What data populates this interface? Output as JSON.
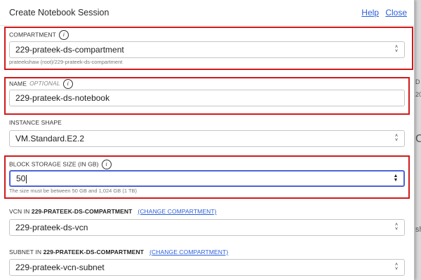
{
  "dialog": {
    "title": "Create Notebook Session",
    "help_link": "Help",
    "close_link": "Close"
  },
  "compartment": {
    "label": "COMPARTMENT",
    "value": "229-prateek-ds-compartment",
    "path": "prateekshaw (root)/229-prateek-ds-compartment"
  },
  "name": {
    "label": "NAME",
    "optional": "OPTIONAL",
    "value": "229-prateek-ds-notebook"
  },
  "instance_shape": {
    "label": "INSTANCE SHAPE",
    "value": "VM.Standard.E2.2"
  },
  "block_storage": {
    "label": "BLOCK STORAGE SIZE (IN GB)",
    "value": "50",
    "helper": "The size must be between 50 GB and 1,024 GB (1 TB)"
  },
  "vcn": {
    "label_prefix": "VCN IN",
    "compartment": "229-PRATEEK-DS-COMPARTMENT",
    "change_link": "(CHANGE COMPARTMENT)",
    "value": "229-prateek-ds-vcn"
  },
  "subnet": {
    "label_prefix": "SUBNET IN",
    "compartment": "229-PRATEEK-DS-COMPARTMENT",
    "change_link": "(CHANGE COMPARTMENT)",
    "value": "229-prateek-vcn-subnet"
  },
  "background_fragments": [
    "D",
    "20",
    "Co",
    "sh"
  ],
  "colors": {
    "highlight": "#d11a1a",
    "link": "#2b5fd9",
    "focus": "#4b63d9"
  }
}
